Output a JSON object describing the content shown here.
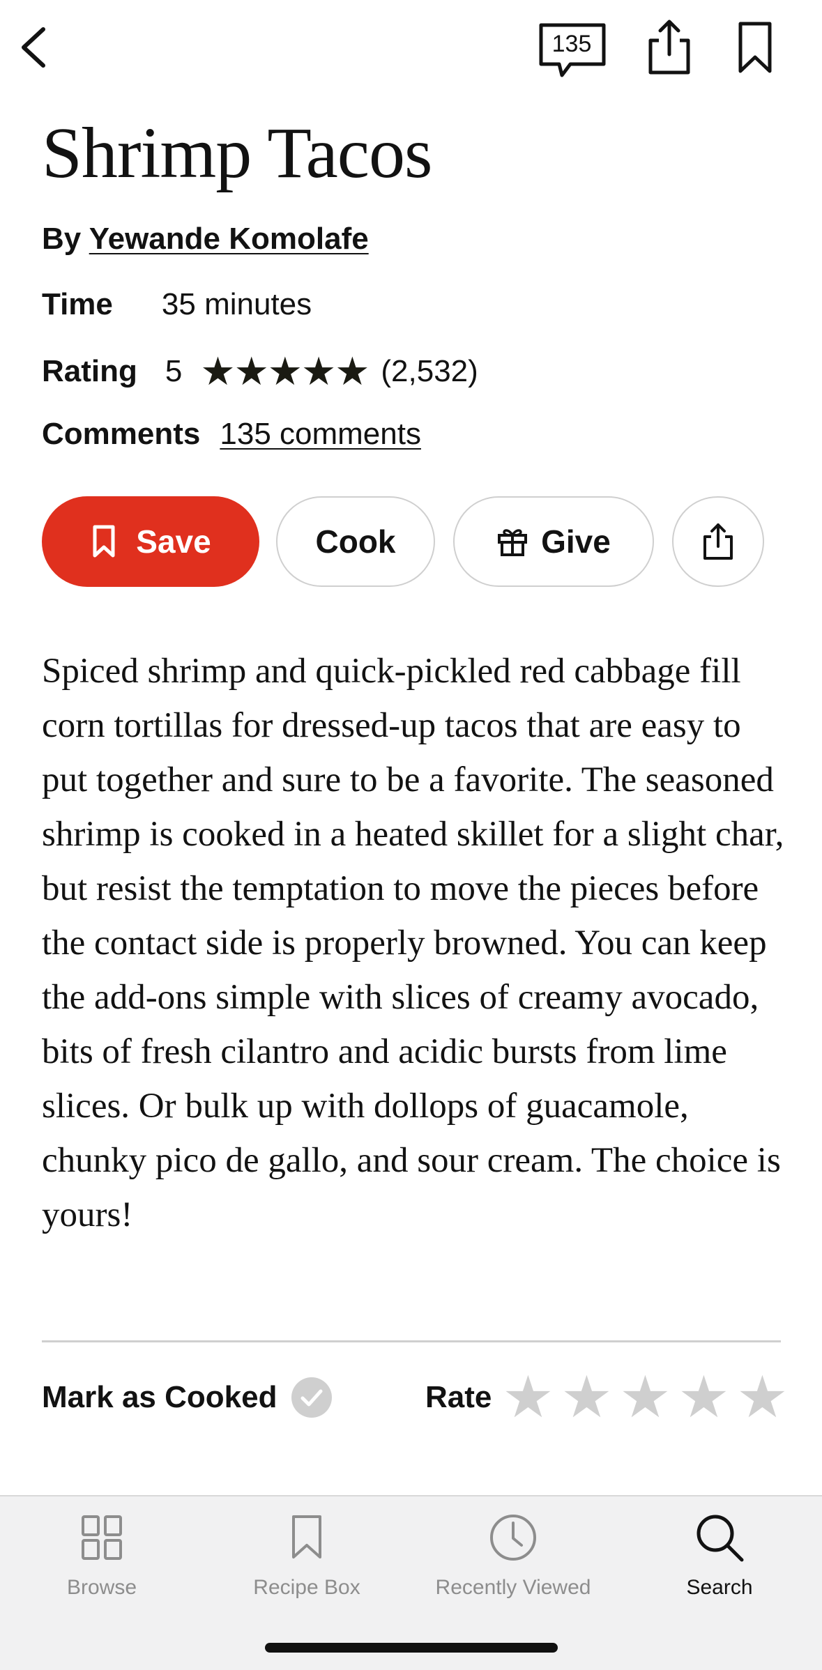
{
  "header": {
    "comment_count": "135"
  },
  "recipe": {
    "title": "Shrimp Tacos",
    "byline_prefix": "By",
    "author": "Yewande Komolafe",
    "time_label": "Time",
    "time_value": "35 minutes",
    "rating_label": "Rating",
    "rating_value": "5",
    "rating_stars": 5,
    "rating_count": "(2,532)",
    "comments_label": "Comments",
    "comments_link": "135 comments",
    "description": "Spiced shrimp and quick-pickled red cabbage fill corn tortillas for dressed-up tacos that are easy to put together and sure to be a favorite. The seasoned shrimp is cooked in a heated skillet for a slight char, but resist the temptation to move the pieces before the contact side is properly browned. You can keep the add-ons simple with slices of creamy avocado, bits of fresh cilantro and acidic bursts from lime slices. Or bulk up with dollops of guacamole, chunky pico de gallo, and sour cream. The choice is yours!"
  },
  "actions": {
    "save_label": "Save",
    "cook_label": "Cook",
    "give_label": "Give"
  },
  "feedback": {
    "mark_cooked_label": "Mark as Cooked",
    "rate_label": "Rate",
    "user_rating": 0
  },
  "tabs": [
    {
      "label": "Browse",
      "icon": "grid-icon"
    },
    {
      "label": "Recipe Box",
      "icon": "bookmark-icon"
    },
    {
      "label": "Recently Viewed",
      "icon": "clock-icon"
    },
    {
      "label": "Search",
      "icon": "search-icon",
      "active": true
    }
  ],
  "colors": {
    "accent": "#e0301e",
    "text": "#121212",
    "muted": "#8d8d8d",
    "border": "#cfcfcf"
  }
}
